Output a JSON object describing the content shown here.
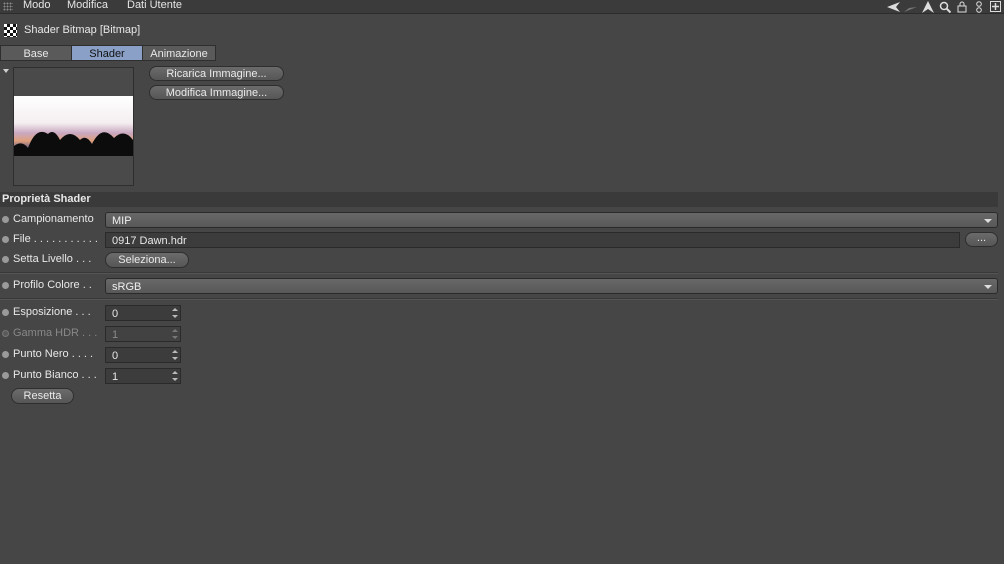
{
  "menu": {
    "items": [
      "Modo",
      "Modifica",
      "Dati Utente"
    ]
  },
  "toolbar": {
    "icons": [
      "arrow-left-icon",
      "arrow-right-icon",
      "cursor-up-icon",
      "search-icon",
      "lock-icon",
      "link-icon",
      "new-panel-icon"
    ]
  },
  "object": {
    "title": "Shader Bitmap [Bitmap]",
    "icon": "checkerboard-icon"
  },
  "tabs": [
    {
      "label": "Base",
      "active": false
    },
    {
      "label": "Shader",
      "active": true
    },
    {
      "label": "Animazione",
      "active": false
    }
  ],
  "preview_buttons": {
    "reload": "Ricarica Immagine...",
    "edit": "Modifica Immagine..."
  },
  "section": {
    "title": "Proprietà Shader"
  },
  "fields": {
    "sampling": {
      "label": "Campionamento",
      "value": "MIP"
    },
    "file": {
      "label": "File . . . . . . . . . . .",
      "value": "0917 Dawn.hdr",
      "browse": "..."
    },
    "layer": {
      "label": "Setta Livello . . .",
      "button": "Seleziona..."
    },
    "color_profile": {
      "label": "Profilo Colore . .",
      "value": "sRGB"
    },
    "exposure": {
      "label": "Esposizione  . . .",
      "value": "0"
    },
    "gamma": {
      "label": "Gamma HDR . . .",
      "value": "1"
    },
    "black_point": {
      "label": "Punto Nero . . . .",
      "value": "0"
    },
    "white_point": {
      "label": "Punto Bianco . . .",
      "value": "1"
    }
  },
  "reset_button": "Resetta",
  "colors": {
    "active_tab": "#8aa0c6",
    "panel_bg": "#464646"
  }
}
